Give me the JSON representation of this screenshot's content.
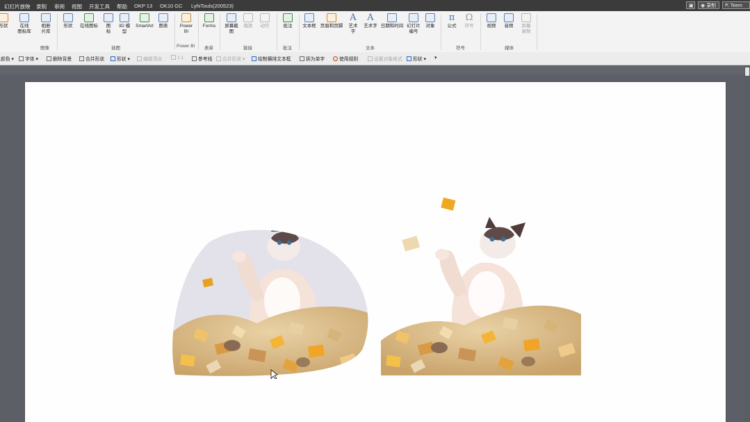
{
  "tabs": [
    "幻灯片放映",
    "录制",
    "审阅",
    "视图",
    "开发工具",
    "帮助",
    "OKP 13",
    "OK10 GC",
    "LyhiTouls(200523)"
  ],
  "titlebar_right": {
    "record_label": "录制",
    "share_label": "Teem"
  },
  "ribbon": {
    "buttons": [
      "形状",
      "在线\n图标库",
      "相册\n片库",
      "形状",
      "在线图标",
      "图\n标",
      "3D 模\n型",
      "SmartArt",
      "图表",
      "Power\nBI",
      "Forms",
      "屏幕截\n图",
      "缩放",
      "动作",
      "批注",
      "文本框",
      "页眉和页脚",
      "艺术\n字",
      "艺术字",
      "日期和时间",
      "幻灯片\n编号",
      "对象",
      "公式",
      "符号",
      "视频",
      "音频",
      "屏幕\n录制"
    ],
    "groups": [
      "图像",
      "插图",
      "Power BI",
      "表单",
      "链接",
      "批注",
      "文本",
      "符号",
      "媒体"
    ]
  },
  "toolbar": {
    "items": [
      "颜色",
      "字体",
      "删除背景",
      "合并形状",
      "形状",
      "编辑顶点",
      "1:1",
      "参考线",
      "合并形状",
      "绘制横排文本框",
      "拆为单字",
      "使用规则",
      "设置对象格式",
      "形状"
    ]
  },
  "icons": [
    "record-icon",
    "share-icon",
    "cat-photo-blob",
    "cat-photo-cutout"
  ],
  "colors": {
    "tab_bar": "#3b3b3b",
    "ribbon": "#f3f3f3",
    "canvas": "#5c6066",
    "slide": "#fefefe"
  }
}
